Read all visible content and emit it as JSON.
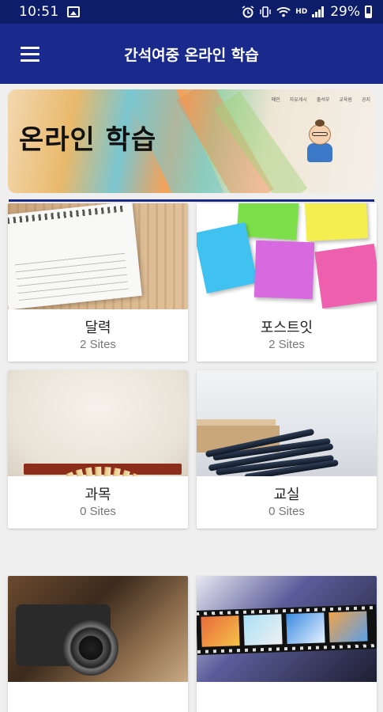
{
  "status_bar": {
    "time": "10:51",
    "battery_text": "29%",
    "network_label": "HD"
  },
  "app_bar": {
    "title": "간석여중 온라인 학습"
  },
  "banner": {
    "heading": "온라인 학습",
    "mini_nav": [
      "메인",
      "자유게시",
      "출석부",
      "교육원",
      "공지"
    ]
  },
  "categories": [
    {
      "name": "달력",
      "count": "2 Sites"
    },
    {
      "name": "포스트잇",
      "count": "2 Sites"
    },
    {
      "name": "과목",
      "count": "0 Sites"
    },
    {
      "name": "교실",
      "count": "0 Sites"
    },
    {
      "name": "",
      "count": ""
    },
    {
      "name": "",
      "count": ""
    }
  ],
  "colors": {
    "status_bar": "#0d1d6a",
    "app_bar": "#1a2a8c",
    "background": "#efefef"
  },
  "images": {
    "card_0": "calendar-photo",
    "card_1": "sticky-notes-photo",
    "card_2": "open-book-photo",
    "card_3": "pens-on-desk-photo",
    "card_4": "camera-photo",
    "card_5": "film-strip-photo"
  }
}
